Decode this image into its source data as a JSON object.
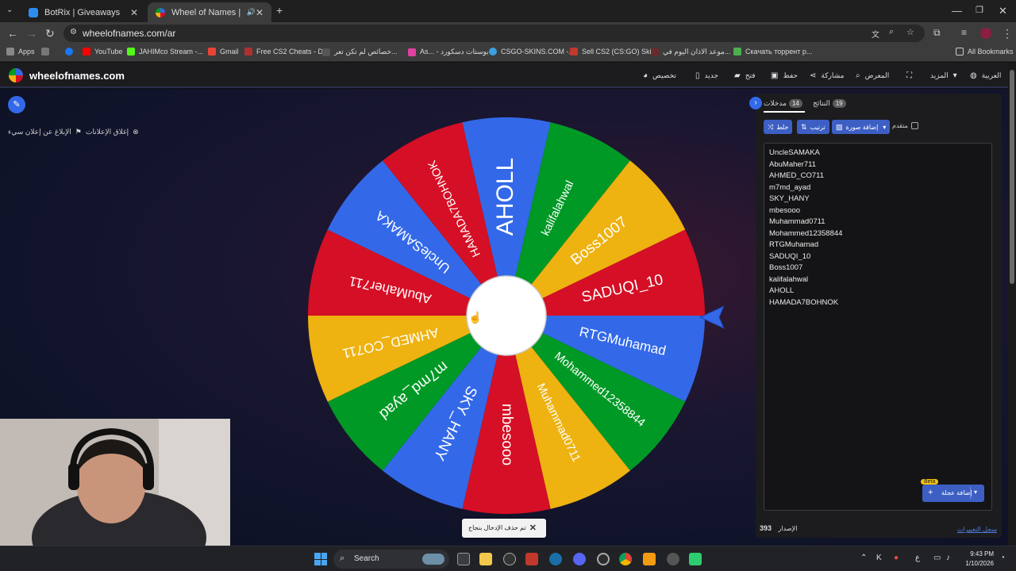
{
  "browser": {
    "tabs": [
      {
        "title": "BotRix | Giveaways",
        "active": false
      },
      {
        "title": "Wheel of Names | العشوائي",
        "active": true
      }
    ],
    "url": "wheelofnames.com/ar",
    "bookmarks": {
      "apps": "Apps",
      "items": [
        "YouTube",
        "JAHIMco Stream -...",
        "Gmail",
        "Free CS2 Cheats - D...",
        "خصائص لم تكن تعر...",
        "As... - بوستات دسكورد",
        "CSGO-SKINS.COM -...",
        "Sell CS2 (CS:GO) Ski...",
        "موعد الاذان اليوم في...",
        "Скачать торрент р..."
      ],
      "all": "All Bookmarks"
    }
  },
  "site": {
    "logo_text": "wheelofnames.com",
    "nav": {
      "customize": "تخصيص",
      "new": "جديد",
      "open": "فتح",
      "save": "حفظ",
      "share": "مشاركة",
      "gallery": "المعرض",
      "more": "المزيد",
      "language": "العربية"
    },
    "close_ads": "إغلاق الإعلانات",
    "report_ad": "الإبلاغ عن إعلان سيء"
  },
  "wheel": {
    "segments": [
      {
        "label": "AHOLL",
        "color": "#3369e8"
      },
      {
        "label": "kalifalahwal",
        "color": "#009925"
      },
      {
        "label": "Boss1007",
        "color": "#eeb211"
      },
      {
        "label": "SADUQI_10",
        "color": "#d50f25"
      },
      {
        "label": "RTGMuhamad",
        "color": "#3369e8"
      },
      {
        "label": "Mohammed12358844",
        "color": "#009925"
      },
      {
        "label": "Muhammad0711",
        "color": "#eeb211"
      },
      {
        "label": "mbesooo",
        "color": "#d50f25"
      },
      {
        "label": "SKY_HANY",
        "color": "#3369e8"
      },
      {
        "label": "m7md_ayad",
        "color": "#009925"
      },
      {
        "label": "AHMED_CO711",
        "color": "#eeb211"
      },
      {
        "label": "AbuMaher711",
        "color": "#d50f25"
      },
      {
        "label": "UncleSAMAKA",
        "color": "#3369e8"
      },
      {
        "label": "HAMADA7BOHNOK",
        "color": "#d50f25"
      }
    ]
  },
  "toast": {
    "text": "تم حذف الإدخال بنجاح"
  },
  "panel": {
    "tab_entries": {
      "label": "مدخلات",
      "count": "14"
    },
    "tab_results": {
      "label": "النتائج",
      "count": "19"
    },
    "shuffle": "خلط",
    "sort": "ترتيب",
    "add_image": "إضافة صورة",
    "advanced": "متقدم",
    "entries": [
      "UncleSAMAKA",
      "AbuMaher711",
      "AHMED_CO711",
      "m7md_ayad",
      "SKY_HANY",
      "mbesooo",
      "Muhammad0711",
      "Mohammed12358844",
      "RTGMuhamad",
      "SADUQI_10",
      "Boss1007",
      "kalifalahwal",
      "AHOLL",
      "HAMADA7BOHNOK"
    ],
    "beta": "Beta",
    "add_wheel": "إضافة عجلة",
    "version_label": "الإصدار",
    "version_number": "393",
    "changelog": "سجل التغييرات"
  },
  "taskbar": {
    "search": "Search",
    "lang": "ع",
    "time": "9:43 PM",
    "date": "1/10/2026"
  },
  "colors": {
    "accent": "#3369e8",
    "wheel_blue": "#3369e8",
    "wheel_green": "#009925",
    "wheel_yellow": "#eeb211",
    "wheel_red": "#d50f25"
  }
}
